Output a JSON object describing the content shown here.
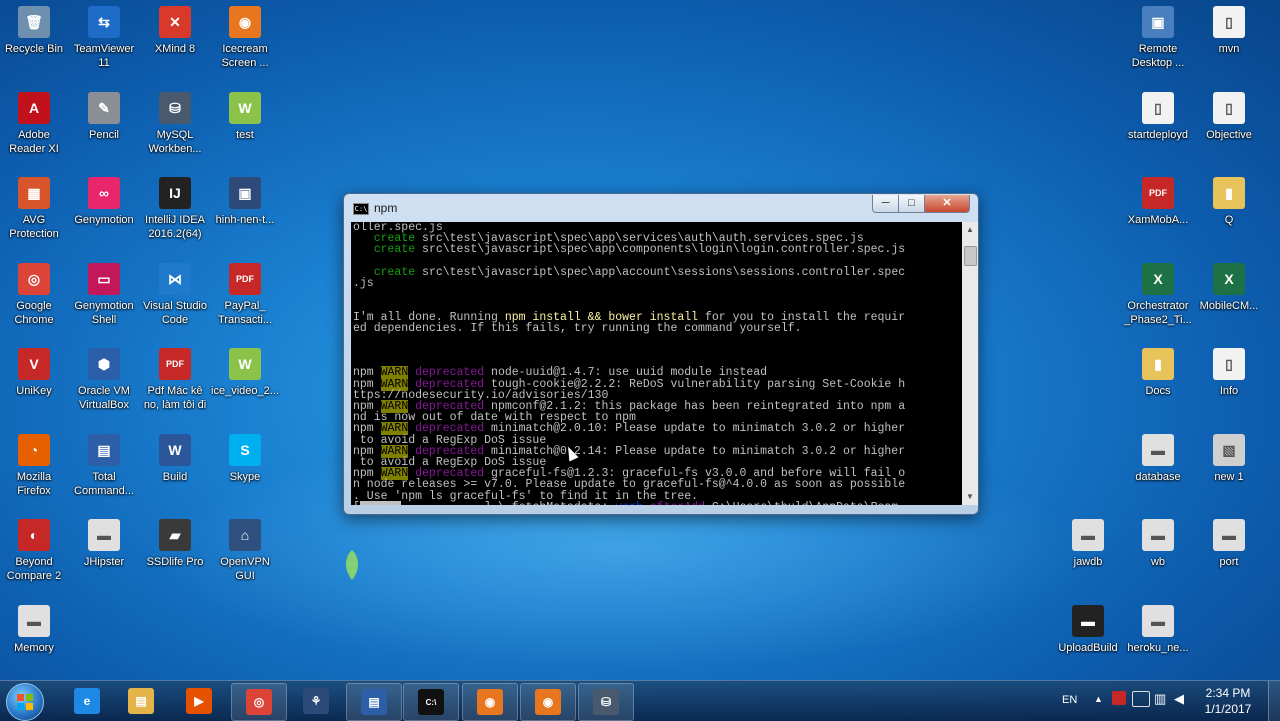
{
  "desktop": {
    "left_icons": [
      {
        "name": "Recycle Bin",
        "lines": [
          "Recycle Bin"
        ],
        "color": "#6f8fae",
        "glyph": "🗑"
      },
      {
        "name": "TeamViewer 11",
        "lines": [
          "TeamViewer",
          "11"
        ],
        "color": "#1e6cc8",
        "glyph": "⇆"
      },
      {
        "name": "XMind 8",
        "lines": [
          "XMind 8"
        ],
        "color": "#d9392b",
        "glyph": "✕"
      },
      {
        "name": "Icecream Screen",
        "lines": [
          "Icecream",
          "Screen ..."
        ],
        "color": "#e8761f",
        "glyph": "◉"
      },
      {
        "name": "Adobe Reader XI",
        "lines": [
          "Adobe",
          "Reader XI"
        ],
        "color": "#c1121c",
        "glyph": "A"
      },
      {
        "name": "Pencil",
        "lines": [
          "Pencil"
        ],
        "color": "#8a8f96",
        "glyph": "✎"
      },
      {
        "name": "MySQL Workbench",
        "lines": [
          "MySQL",
          "Workben..."
        ],
        "color": "#4a5a6e",
        "glyph": "⛁"
      },
      {
        "name": "test",
        "lines": [
          "test"
        ],
        "color": "#8bc34a",
        "glyph": "W"
      },
      {
        "name": "AVG Protection",
        "lines": [
          "AVG",
          "Protection"
        ],
        "color": "#d8542a",
        "glyph": "▦"
      },
      {
        "name": "Genymotion",
        "lines": [
          "Genymotion"
        ],
        "color": "#e9266c",
        "glyph": "∞"
      },
      {
        "name": "IntelliJ IDEA 2016.2(64)",
        "lines": [
          "IntelliJ IDEA",
          "2016.2(64)"
        ],
        "color": "#222222",
        "glyph": "IJ"
      },
      {
        "name": "hinh-nen-t",
        "lines": [
          "hinh-nen-t..."
        ],
        "color": "#2d4a78",
        "glyph": "▣"
      },
      {
        "name": "Google Chrome",
        "lines": [
          "Google",
          "Chrome"
        ],
        "color": "#db4437",
        "glyph": "◎"
      },
      {
        "name": "Genymotion Shell",
        "lines": [
          "Genymotion",
          "Shell"
        ],
        "color": "#c2185b",
        "glyph": "▭"
      },
      {
        "name": "Visual Studio Code",
        "lines": [
          "Visual Studio",
          "Code"
        ],
        "color": "#1f7acb",
        "glyph": "⋈"
      },
      {
        "name": "PayPal_Transacti",
        "lines": [
          "PayPal_",
          "Transacti..."
        ],
        "color": "#c62828",
        "glyph": "PDF"
      },
      {
        "name": "UniKey",
        "lines": [
          "UniKey"
        ],
        "color": "#c62828",
        "glyph": "V"
      },
      {
        "name": "Oracle VM VirtualBox",
        "lines": [
          "Oracle VM",
          "VirtualBox"
        ],
        "color": "#2b5ea8",
        "glyph": "⬢"
      },
      {
        "name": "Pdf Mac ke no lam toi di",
        "lines": [
          "Pdf Mác kê",
          "no, làm tôi đi"
        ],
        "color": "#c62828",
        "glyph": "PDF"
      },
      {
        "name": "ice_video_2",
        "lines": [
          "ice_video_2..."
        ],
        "color": "#8bc34a",
        "glyph": "W"
      },
      {
        "name": "Mozilla Firefox",
        "lines": [
          "Mozilla",
          "Firefox"
        ],
        "color": "#e66000",
        "glyph": "◔"
      },
      {
        "name": "Total Commander",
        "lines": [
          "Total",
          "Command..."
        ],
        "color": "#2d5fa8",
        "glyph": "▤"
      },
      {
        "name": "Build",
        "lines": [
          "Build"
        ],
        "color": "#2b579a",
        "glyph": "W"
      },
      {
        "name": "Skype",
        "lines": [
          "Skype"
        ],
        "color": "#00aff0",
        "glyph": "S"
      },
      {
        "name": "Beyond Compare 2",
        "lines": [
          "Beyond",
          "Compare 2"
        ],
        "color": "#c62828",
        "glyph": "◐"
      },
      {
        "name": "JHipster",
        "lines": [
          "JHipster"
        ],
        "color": "#e0e0e0",
        "glyph": "▬"
      },
      {
        "name": "SSDlife Pro",
        "lines": [
          "SSDlife Pro"
        ],
        "color": "#3a3a3a",
        "glyph": "▰"
      },
      {
        "name": "OpenVPN GUI",
        "lines": [
          "OpenVPN",
          "GUI"
        ],
        "color": "#2f4f7f",
        "glyph": "⌂"
      },
      {
        "name": "Memory",
        "lines": [
          "Memory"
        ],
        "color": "#e0e0e0",
        "glyph": "▬"
      }
    ],
    "right_icons": [
      {
        "name": "Remote Desktop",
        "lines": [
          "Remote",
          "Desktop ..."
        ],
        "color": "#4a7fbf",
        "glyph": "▣"
      },
      {
        "name": "mvn",
        "lines": [
          "mvn"
        ],
        "color": "#f2f2f2",
        "glyph": "▯"
      },
      {
        "name": "startdeployd",
        "lines": [
          "startdeployd"
        ],
        "color": "#f2f2f2",
        "glyph": "▯"
      },
      {
        "name": "Objective",
        "lines": [
          "Objective"
        ],
        "color": "#f2f2f2",
        "glyph": "▯"
      },
      {
        "name": "XamMobA",
        "lines": [
          "XamMobA..."
        ],
        "color": "#c62828",
        "glyph": "PDF"
      },
      {
        "name": "Q",
        "lines": [
          "Q"
        ],
        "color": "#e8c25a",
        "glyph": "▮"
      },
      {
        "name": "Orchestrator_Phase2_Ti",
        "lines": [
          "Orchestrator",
          "_Phase2_Ti..."
        ],
        "color": "#1e7145",
        "glyph": "X"
      },
      {
        "name": "MobileCM",
        "lines": [
          "MobileCM..."
        ],
        "color": "#1e7145",
        "glyph": "X"
      },
      {
        "name": "Docs",
        "lines": [
          "Docs"
        ],
        "color": "#e8c25a",
        "glyph": "▮"
      },
      {
        "name": "Info",
        "lines": [
          "Info"
        ],
        "color": "#f2f2f2",
        "glyph": "▯"
      },
      {
        "name": "database",
        "lines": [
          "database"
        ],
        "color": "#e0e0e0",
        "glyph": "▬"
      },
      {
        "name": "new 1",
        "lines": [
          "new 1"
        ],
        "color": "#cfcfcf",
        "glyph": "▧"
      },
      {
        "name": "jawdb",
        "lines": [
          "jawdb"
        ],
        "color": "#e0e0e0",
        "glyph": "▬"
      },
      {
        "name": "wb",
        "lines": [
          "wb"
        ],
        "color": "#e0e0e0",
        "glyph": "▬"
      },
      {
        "name": "port",
        "lines": [
          "port"
        ],
        "color": "#e0e0e0",
        "glyph": "▬"
      },
      {
        "name": "UploadBuild",
        "lines": [
          "UploadBuild"
        ],
        "color": "#222222",
        "glyph": "▬"
      },
      {
        "name": "heroku_ne",
        "lines": [
          "heroku_ne..."
        ],
        "color": "#e0e0e0",
        "glyph": "▬"
      }
    ]
  },
  "window": {
    "title": "npm",
    "title_icon": "C:\\",
    "minimize": "─",
    "maximize": "□",
    "close": "✕",
    "console_lines": [
      [
        {
          "t": "oller.spec.js"
        }
      ],
      [
        {
          "t": "   "
        },
        {
          "t": "create",
          "c": "c-green"
        },
        {
          "t": " src\\test\\javascript\\spec\\app\\services\\auth\\auth.services.spec.js"
        }
      ],
      [
        {
          "t": "   "
        },
        {
          "t": "create",
          "c": "c-green"
        },
        {
          "t": " src\\test\\javascript\\spec\\app\\components\\login\\login.controller.spec.js"
        }
      ],
      [
        {
          "t": ""
        }
      ],
      [
        {
          "t": "   "
        },
        {
          "t": "create",
          "c": "c-green"
        },
        {
          "t": " src\\test\\javascript\\spec\\app\\account\\sessions\\sessions.controller.spec"
        }
      ],
      [
        {
          "t": ".js"
        }
      ],
      [
        {
          "t": ""
        }
      ],
      [
        {
          "t": ""
        }
      ],
      [
        {
          "t": "I'm all done. Running "
        },
        {
          "t": "npm install && bower install",
          "c": "c-yel"
        },
        {
          "t": " for you to install the requir"
        }
      ],
      [
        {
          "t": "ed dependencies. If this fails, try running the command yourself."
        }
      ],
      [
        {
          "t": ""
        }
      ],
      [
        {
          "t": ""
        }
      ],
      [
        {
          "t": ""
        }
      ],
      [
        {
          "t": "npm "
        },
        {
          "t": "WARN",
          "c": "c-warn"
        },
        {
          "t": " "
        },
        {
          "t": "deprecated",
          "c": "c-mag"
        },
        {
          "t": " node-uuid@1.4.7: use uuid module instead"
        }
      ],
      [
        {
          "t": "npm "
        },
        {
          "t": "WARN",
          "c": "c-warn"
        },
        {
          "t": " "
        },
        {
          "t": "deprecated",
          "c": "c-mag"
        },
        {
          "t": " tough-cookie@2.2.2: ReDoS vulnerability parsing Set-Cookie h"
        }
      ],
      [
        {
          "t": "ttps://nodesecurity.io/advisories/130"
        }
      ],
      [
        {
          "t": "npm "
        },
        {
          "t": "WARN",
          "c": "c-warn"
        },
        {
          "t": " "
        },
        {
          "t": "deprecated",
          "c": "c-mag"
        },
        {
          "t": " npmconf@2.1.2: this package has been reintegrated into npm a"
        }
      ],
      [
        {
          "t": "nd is now out of date with respect to npm"
        }
      ],
      [
        {
          "t": "npm "
        },
        {
          "t": "WARN",
          "c": "c-warn"
        },
        {
          "t": " "
        },
        {
          "t": "deprecated",
          "c": "c-mag"
        },
        {
          "t": " minimatch@2.0.10: Please update to minimatch 3.0.2 or higher"
        }
      ],
      [
        {
          "t": " to avoid a RegExp DoS issue"
        }
      ],
      [
        {
          "t": "npm "
        },
        {
          "t": "WARN",
          "c": "c-warn"
        },
        {
          "t": " "
        },
        {
          "t": "deprecated",
          "c": "c-mag"
        },
        {
          "t": " minimatch@0.2.14: Please update to minimatch 3.0.2 or higher"
        }
      ],
      [
        {
          "t": " to avoid a RegExp DoS issue"
        }
      ],
      [
        {
          "t": "npm "
        },
        {
          "t": "WARN",
          "c": "c-warn"
        },
        {
          "t": " "
        },
        {
          "t": "deprecated",
          "c": "c-mag"
        },
        {
          "t": " graceful-fs@1.2.3: graceful-fs v3.0.0 and before will fail o"
        }
      ],
      [
        {
          "t": "n node releases >= v7.0. Please update to graceful-fs@^4.0.0 as soon as possible"
        }
      ],
      [
        {
          "t": ". Use 'npm ls graceful-fs' to find it in the tree."
        }
      ],
      [
        {
          "t": "["
        },
        {
          "t": "      ",
          "c": "c-bar"
        },
        {
          "t": "............] \\ fetchMetadata: "
        },
        {
          "t": "verb",
          "c": "c-blue"
        },
        {
          "t": " "
        },
        {
          "t": "afterAdd",
          "c": "c-mag"
        },
        {
          "t": " C:\\Users\\thuld\\AppData\\Roam"
        }
      ]
    ]
  },
  "taskbar": {
    "apps": [
      {
        "name": "internet-explorer",
        "glyph": "e",
        "color": "#1e88e5",
        "pinned": false
      },
      {
        "name": "file-explorer",
        "glyph": "▤",
        "color": "#e2b44a",
        "pinned": false
      },
      {
        "name": "media-player",
        "glyph": "▶",
        "color": "#e65100",
        "pinned": false
      },
      {
        "name": "google-chrome",
        "glyph": "◎",
        "color": "#db4437",
        "pinned": true
      },
      {
        "name": "sourcetree",
        "glyph": "⚘",
        "color": "#2d4a78",
        "pinned": false
      },
      {
        "name": "total-commander",
        "glyph": "▤",
        "color": "#2d5fa8",
        "pinned": true
      },
      {
        "name": "command-prompt",
        "glyph": "C:\\",
        "color": "#111111",
        "pinned": true
      },
      {
        "name": "icecream-screen-recorder",
        "glyph": "◉",
        "color": "#e8761f",
        "pinned": true
      },
      {
        "name": "icecream-screen-capture",
        "glyph": "◉",
        "color": "#e8761f",
        "pinned": true
      },
      {
        "name": "mysql-workbench",
        "glyph": "⛁",
        "color": "#4a5a6e",
        "pinned": true
      }
    ],
    "language": "EN",
    "time": "2:34 PM",
    "date": "1/1/2017"
  }
}
